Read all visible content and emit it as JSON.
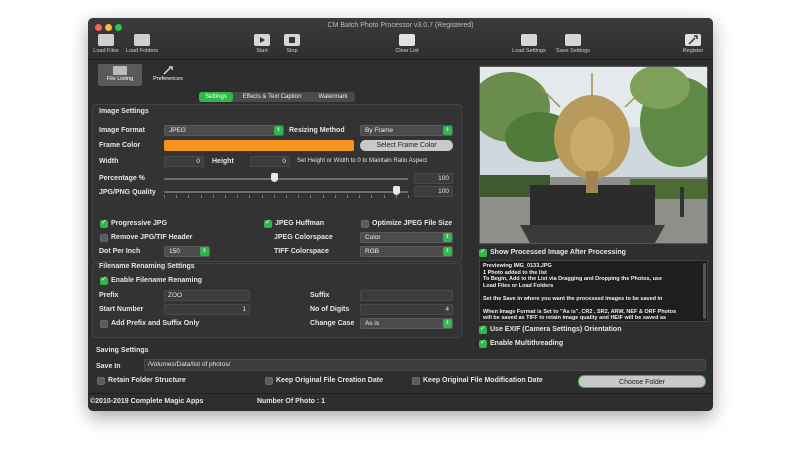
{
  "window": {
    "title": "CM Batch Photo Processor v3.0.7 (Registered)"
  },
  "toolbar": {
    "load_files": "Load Files",
    "load_folders": "Load Folders",
    "start": "Start",
    "stop": "Stop",
    "clear_list": "Clear List",
    "load_settings": "Load Settings",
    "save_settings": "Save Settings",
    "register": "Register"
  },
  "modes": {
    "file_listing": "File Listing",
    "preferences": "Preferences"
  },
  "tabs": {
    "settings": "Settings",
    "effects": "Effects & Text Caption",
    "watermark": "Watermark"
  },
  "image_settings": {
    "header": "Image Settings",
    "image_format_label": "Image Format",
    "image_format_value": "JPEG",
    "resizing_method_label": "Resizing Method",
    "resizing_method_value": "By Frame",
    "frame_color_label": "Frame Color",
    "frame_color": "#f7941d",
    "select_frame_color": "Select Frame Color",
    "width_label": "Width",
    "width_value": "0",
    "height_label": "Height",
    "height_value": "0",
    "aspect_note": "Set Height or Width to 0 to Maintain Ratio Aspect",
    "percentage_label": "Percentage %",
    "percentage_value": "100",
    "percentage_fraction": 0.45,
    "quality_label": "JPG/PNG Quality",
    "quality_value": "100",
    "quality_fraction": 0.95,
    "progressive_jpg": "Progressive JPG",
    "jpeg_huffman": "JPEG Huffman",
    "optimize_jpeg": "Optimize JPEG File Size",
    "remove_header": "Remove JPG/TIF Header",
    "jpeg_colorspace_label": "JPEG Colorspace",
    "jpeg_colorspace_value": "Color",
    "dpi_label": "Dot Per Inch",
    "dpi_value": "150",
    "tiff_colorspace_label": "TIFF Colorspace",
    "tiff_colorspace_value": "RGB"
  },
  "renaming": {
    "header": "Filename Renaming Settings",
    "enable": "Enable Filename Renaming",
    "prefix_label": "Prefix",
    "prefix_value": "ZOO",
    "suffix_label": "Suffix",
    "suffix_value": "",
    "start_number_label": "Start Number",
    "start_number_value": "1",
    "digits_label": "No of Digits",
    "digits_value": "4",
    "add_prefix_suffix_only": "Add Prefix and Suffix Only",
    "change_case_label": "Change Case",
    "change_case_value": "As is"
  },
  "preview": {
    "show_processed": "Show Processed Image After Processing",
    "log_lines": [
      "Previewing IMG_0133.JPG",
      "1 Photo added to the list",
      "To Begin, Add to the List via Dragging and Dropping the Photos, use",
      "Load Files or Load Folders",
      "",
      "Set the Save in where you want the processed images to be saved in",
      "",
      "When Image Format is Set to \"As is\", CR2 , SR2, ARW, NEF & ORF Photos",
      "will be saved as TIFF to retain image quality and HEIF will be saved as"
    ],
    "use_exif": "Use EXIF (Camera Settings) Orientation",
    "multithreading": "Enable Multithreading"
  },
  "saving": {
    "header": "Saving Settings",
    "save_in_label": "Save In",
    "save_in_value": "/Volumes/Data/list of photos/",
    "retain_folder": "Retain Folder Structure",
    "keep_creation": "Keep Original File Creation Date",
    "keep_modification": "Keep Original File Modification Date",
    "choose_folder": "Choose Folder"
  },
  "status": {
    "copyright": "©2010-2019 Complete Magic Apps",
    "photo_count": "Number Of Photo : 1"
  }
}
